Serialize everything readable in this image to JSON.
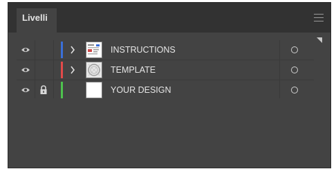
{
  "panel": {
    "tab_label": "Livelli"
  },
  "layers": [
    {
      "name": "INSTRUCTIONS",
      "color": "#3a6fd8",
      "visible": true,
      "locked": false,
      "expandable": true,
      "thumbnail": "instructions-thumbnail"
    },
    {
      "name": "TEMPLATE",
      "color": "#e24a4a",
      "visible": true,
      "locked": false,
      "expandable": true,
      "thumbnail": "template-thumbnail"
    },
    {
      "name": "YOUR DESIGN",
      "color": "#4ec24e",
      "visible": true,
      "locked": true,
      "expandable": false,
      "thumbnail": "blank-thumbnail"
    }
  ],
  "icons": {
    "visibility": "eye-icon",
    "lock": "lock-icon",
    "expand": "chevron-right-icon",
    "target": "target-circle-icon",
    "menu": "hamburger-menu-icon"
  },
  "colors": {
    "panel_bg": "#434343",
    "tabbar_bg": "#323232",
    "text": "#e6e6e6"
  }
}
